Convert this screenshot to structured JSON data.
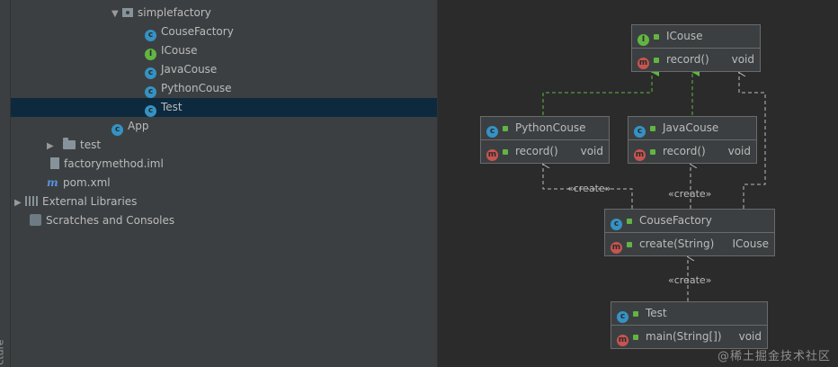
{
  "sidebar": {
    "strip_label": "cture",
    "tree": [
      {
        "label": "simplefactory",
        "icon": "package-icon",
        "expanded": true
      },
      {
        "label": "CouseFactory",
        "icon": "class-icon"
      },
      {
        "label": "ICouse",
        "icon": "interface-icon"
      },
      {
        "label": "JavaCouse",
        "icon": "class-icon"
      },
      {
        "label": "PythonCouse",
        "icon": "class-icon"
      },
      {
        "label": "Test",
        "icon": "runnable-class-icon",
        "selected": true
      },
      {
        "label": "App",
        "icon": "runnable-class-icon"
      },
      {
        "label": "test",
        "icon": "folder-icon",
        "expanded": false
      },
      {
        "label": "factorymethod.iml",
        "icon": "iml-file-icon"
      },
      {
        "label": "pom.xml",
        "icon": "maven-icon"
      },
      {
        "label": "External Libraries",
        "icon": "libraries-icon",
        "expanded": false
      },
      {
        "label": "Scratches and Consoles",
        "icon": "scratches-icon"
      }
    ]
  },
  "diagram": {
    "nodes": {
      "icouse": {
        "name": "ICouse",
        "kind": "interface",
        "method": "record()",
        "ret": "void"
      },
      "python": {
        "name": "PythonCouse",
        "kind": "class",
        "method": "record()",
        "ret": "void"
      },
      "java": {
        "name": "JavaCouse",
        "kind": "class",
        "method": "record()",
        "ret": "void"
      },
      "factory": {
        "name": "CouseFactory",
        "kind": "class",
        "method": "create(String)",
        "ret": "ICouse"
      },
      "test": {
        "name": "Test",
        "kind": "class",
        "method": "main(String[])",
        "ret": "void"
      }
    },
    "labels": {
      "create1": "«create»",
      "create2": "«create»",
      "create3": "«create»"
    }
  },
  "watermark": "@稀土掘金技术社区",
  "colors": {
    "class": "#3592c4",
    "interface": "#62b543",
    "method": "#c75450",
    "selection": "#0d293e",
    "edge_realize": "#62b543"
  }
}
